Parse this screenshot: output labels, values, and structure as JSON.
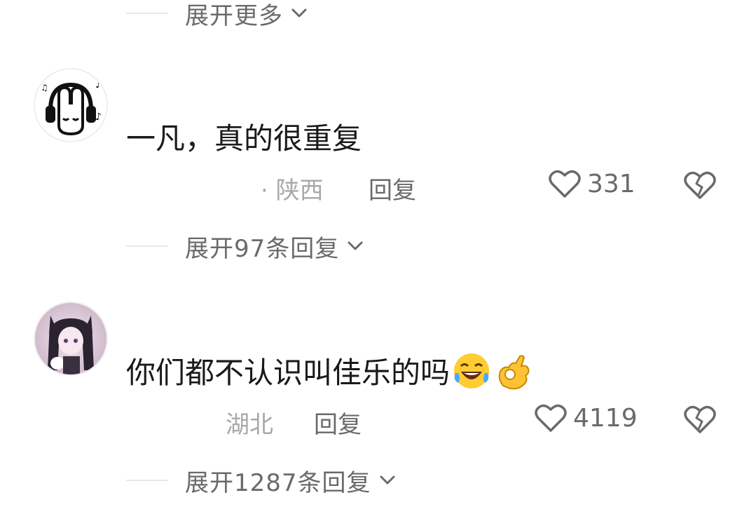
{
  "top_expand": {
    "label": "展开更多"
  },
  "comments": [
    {
      "text": "一凡，真的很重复",
      "location": "· 陕西",
      "reply_label": "回复",
      "likes": "331",
      "expand_label": "展开97条回复"
    },
    {
      "text": "你们都不认识叫佳乐的吗",
      "emojis": [
        "laughing-crying-emoji",
        "ok-hand-emoji"
      ],
      "location": "湖北",
      "reply_label": "回复",
      "likes": "4119",
      "expand_label": "展开1287条回复"
    }
  ],
  "colors": {
    "text": "#1a1a1a",
    "secondary": "#6a6a6a",
    "muted": "#a8a8a8"
  }
}
